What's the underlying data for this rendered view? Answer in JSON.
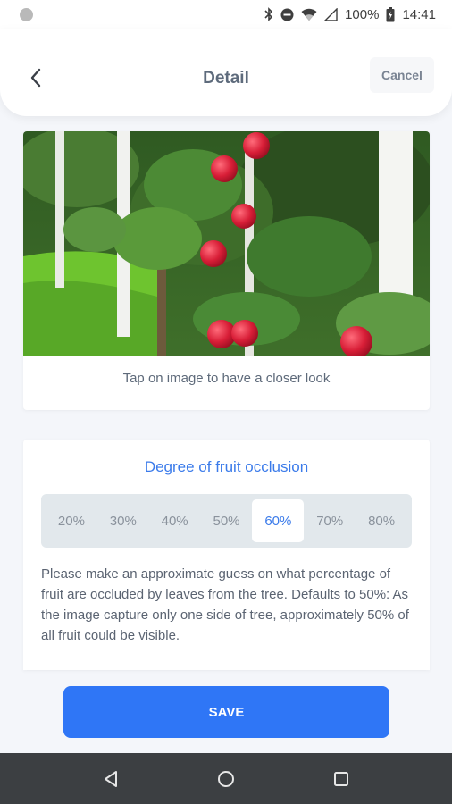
{
  "status_bar": {
    "battery": "100%",
    "time": "14:41",
    "icons": [
      "notification-dot-icon",
      "bluetooth-icon",
      "do-not-disturb-icon",
      "wifi-icon",
      "signal-icon",
      "battery-icon"
    ]
  },
  "header": {
    "title": "Detail",
    "cancel_label": "Cancel",
    "back_icon": "chevron-left-icon"
  },
  "image_card": {
    "image_subject": "apple-orchard-photo",
    "hint": "Tap on image to have a closer look"
  },
  "occlusion": {
    "title": "Degree of fruit occlusion",
    "options": [
      "20%",
      "30%",
      "40%",
      "50%",
      "60%",
      "70%",
      "80%"
    ],
    "selected": "60%",
    "description": "Please make an approximate guess on what percentage of fruit are occluded by leaves from the tree. Defaults to 50%: As the image capture only one side of tree, approximately 50% of all fruit could be visible."
  },
  "save_label": "SAVE",
  "nav": {
    "icons": [
      "nav-back-icon",
      "nav-home-icon",
      "nav-recents-icon"
    ]
  },
  "colors": {
    "accent": "#2f76f6",
    "title_blue": "#3b7bea",
    "nav_bar": "#3c3f42",
    "segment_bg": "#e2e8ec"
  }
}
